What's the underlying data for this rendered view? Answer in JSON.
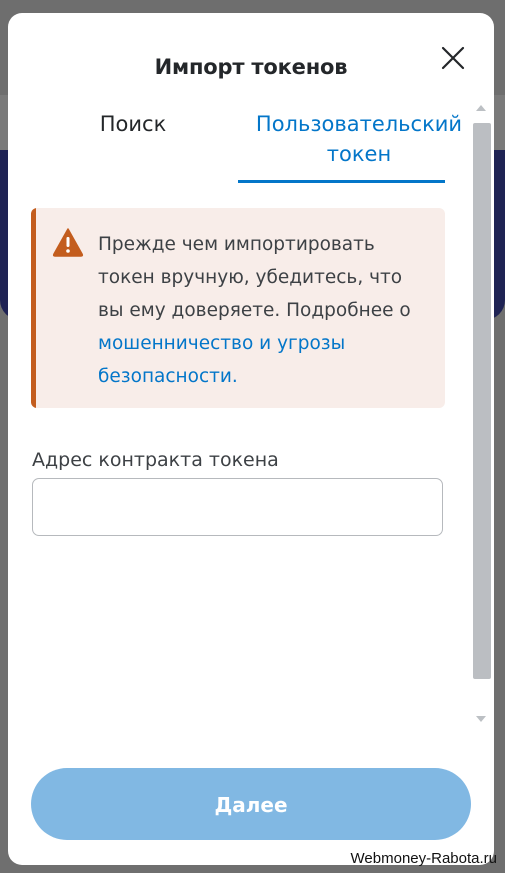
{
  "modal": {
    "title": "Импорт токенов",
    "close_icon": "close-icon"
  },
  "tabs": [
    {
      "label": "Поиск",
      "active": false
    },
    {
      "label": "Пользовательский токен",
      "active": true
    }
  ],
  "warning": {
    "icon": "warning-icon",
    "text": "Прежде чем импортировать токен вручную, убедитесь, что вы ему доверяете. Подробнее о ",
    "link_text": "мошенничество и угрозы безопасности."
  },
  "contract_field": {
    "label": "Адрес контракта токена",
    "value": "",
    "placeholder": ""
  },
  "next_button": {
    "label": "Далее",
    "enabled": false
  },
  "watermark": "Webmoney-Rabota.ru",
  "colors": {
    "accent": "#0376c9",
    "warning": "#c35d1e",
    "warning_bg": "#f8ede9",
    "button_disabled": "#81b8e3"
  }
}
